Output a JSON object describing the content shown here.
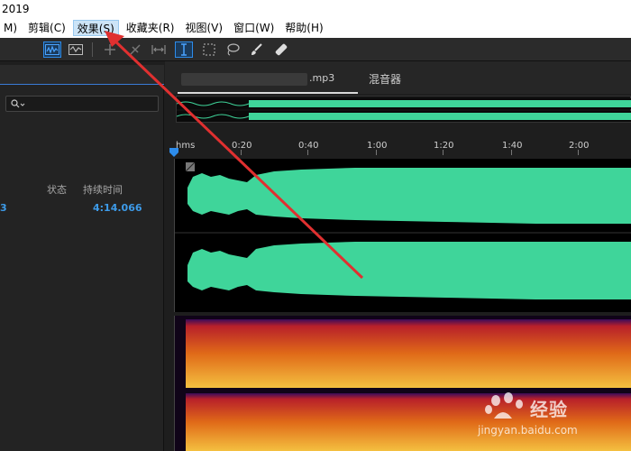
{
  "window": {
    "title": "2019"
  },
  "menu": {
    "items": [
      {
        "label": "M)"
      },
      {
        "label": "剪辑(C)"
      },
      {
        "label": "效果(S)"
      },
      {
        "label": "收藏夹(R)"
      },
      {
        "label": "视图(V)"
      },
      {
        "label": "窗口(W)"
      },
      {
        "label": "帮助(H)"
      }
    ],
    "active_index": 2
  },
  "toolbar": {
    "icons": [
      "waveform-view-icon",
      "spectral-view-icon",
      "move-tool-icon",
      "razor-tool-icon",
      "slip-tool-icon",
      "time-selection-tool-icon",
      "marquee-tool-icon",
      "lasso-tool-icon",
      "brush-tool-icon",
      "spot-healing-icon"
    ],
    "active": [
      "waveform-view-icon",
      "time-selection-tool-icon"
    ]
  },
  "files_panel": {
    "columns": {
      "status": "状态",
      "duration": "持续时间"
    },
    "rows": [
      {
        "name_tail": "3",
        "duration": "4:14.066"
      }
    ]
  },
  "editor": {
    "file_tab_suffix": ".mp3",
    "mixer_tab": "混音器",
    "ruler": {
      "unit": "hms",
      "labels": [
        "0:20",
        "0:40",
        "1:00",
        "1:20",
        "1:40",
        "2:00"
      ]
    }
  },
  "colors": {
    "waveform": "#3fd59a",
    "accent": "#2d8ceb",
    "arrow": "#e03030"
  },
  "watermark": {
    "logo_text": "经验",
    "url": "jingyan.baidu.com"
  }
}
